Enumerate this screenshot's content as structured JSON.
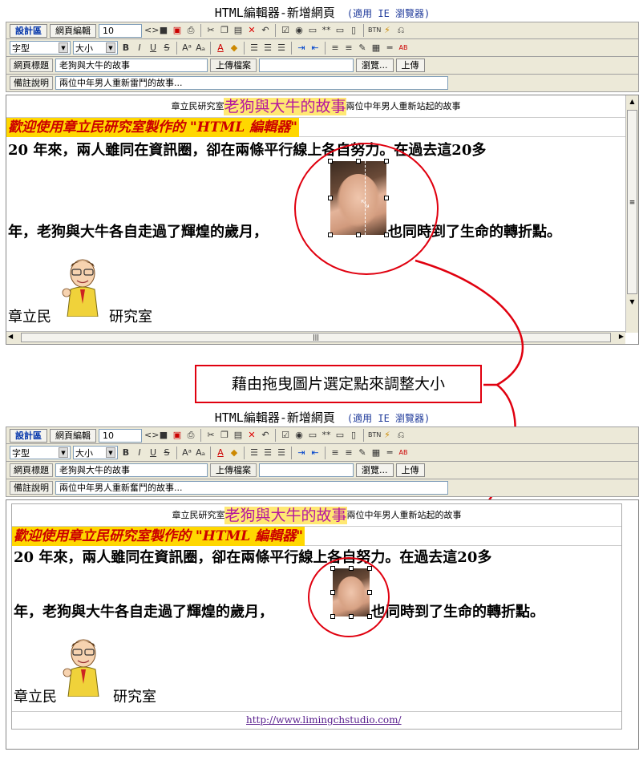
{
  "app_title": "HTML編輯器-新增網頁",
  "browser_note": "(適用 IE 瀏覽器)",
  "toolbar": {
    "design_tab": "設計區",
    "source_tab": "網頁編輯",
    "font_size_value": "10",
    "font_select": "字型",
    "size_select": "大小",
    "page_title_label": "網頁標題",
    "page_title_value": "老狗與大牛的故事",
    "upload_label": "上傳檔案",
    "browse_btn": "瀏覽...",
    "upload_btn": "上傳",
    "desc_label": "備註說明",
    "desc_value_top": "兩位中年男人重新雷鬥的故事...",
    "desc_value_bottom": "兩位中年男人重新奮鬥的故事..."
  },
  "content": {
    "studio_small": "章立民研究室",
    "story_title": "老狗與大牛的故事",
    "subtitle_small": "兩位中年男人重新站起的故事",
    "banner": "歡迎使用章立民研究室製作的 \"HTML 編輯器\"",
    "para1": "20 年來，兩人雖同在資訊圈，卻在兩條平行線上各自努力。在過去這20多",
    "para2_a": "年，老狗與大牛各自走過了輝煌的歲月，",
    "para2_b": "也同時到了生命的轉折點。",
    "author": "章立民",
    "studio": "研究室",
    "link": "http://www.limingchstudio.com/"
  },
  "callout": "藉由拖曳圖片選定點來調整大小",
  "colors": {
    "annotation_red": "#e0000f",
    "toolbar_bg": "#ece9d8",
    "title_pink": "#b5179e",
    "highlight_yellow": "#ffe873"
  }
}
